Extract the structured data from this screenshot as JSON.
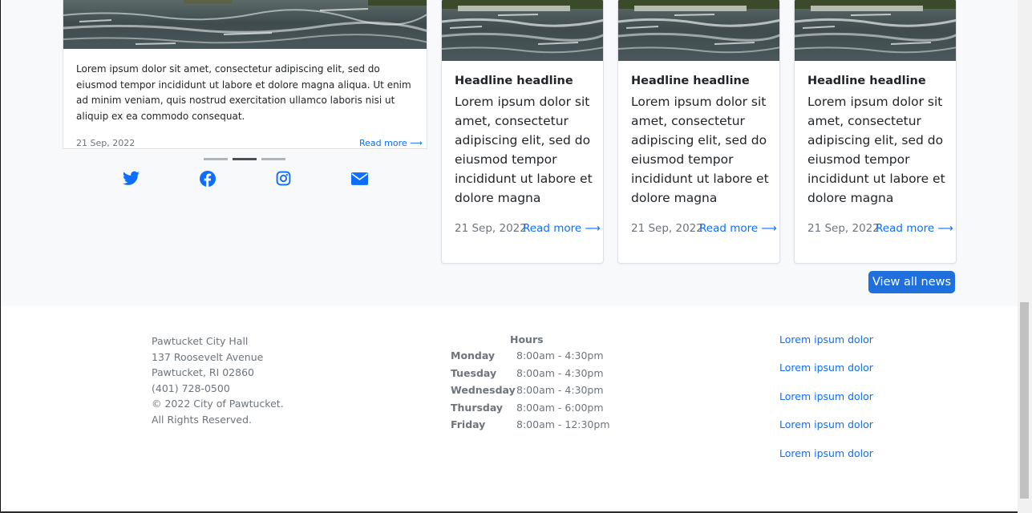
{
  "featured": {
    "text": "Lorem ipsum dolor sit amet, consectetur adipiscing elit, sed do eiusmod tempor incididunt ut labore et dolore magna aliqua. Ut enim ad minim veniam, quis nostrud exercitation ullamco laboris nisi ut aliquip ex ea commodo consequat.",
    "date": "21 Sep, 2022",
    "read_more": "Read more ⟶"
  },
  "carousel": {
    "slides": 3,
    "active_index": 1
  },
  "social": [
    "twitter-icon",
    "facebook-icon",
    "instagram-icon",
    "mail-icon"
  ],
  "cards": [
    {
      "title": "Headline headline",
      "text": "Lorem ipsum dolor sit amet, consectetur adipiscing elit, sed do eiusmod tempor incididunt ut labore et dolore magna",
      "date": "21 Sep, 2022",
      "read_more": "Read more ⟶"
    },
    {
      "title": "Headline headline",
      "text": "Lorem ipsum dolor sit amet, consectetur adipiscing elit, sed do eiusmod tempor incididunt ut labore et dolore magna",
      "date": "21 Sep, 2022",
      "read_more": "Read more ⟶"
    },
    {
      "title": "Headline headline",
      "text": "Lorem ipsum dolor sit amet, consectetur adipiscing elit, sed do eiusmod tempor incididunt ut labore et dolore magna",
      "date": "21 Sep, 2022",
      "read_more": "Read more ⟶"
    }
  ],
  "view_all": "View all news",
  "footer": {
    "address": [
      "Pawtucket City Hall",
      "137 Roosevelt Avenue",
      "Pawtucket, RI 02860",
      "(401) 728-0500",
      "© 2022 City of Pawtucket.",
      "All Rights Reserved."
    ],
    "hours_title": "Hours",
    "hours": [
      {
        "day": "Monday",
        "time": "8:00am - 4:30pm"
      },
      {
        "day": "Tuesday",
        "time": "8:00am - 4:30pm"
      },
      {
        "day": "Wednesday",
        "time": "8:00am - 4:30pm"
      },
      {
        "day": "Thursday",
        "time": "8:00am - 6:00pm"
      },
      {
        "day": "Friday",
        "time": "8:00am - 12:30pm"
      }
    ],
    "links": [
      "Lorem ipsum dolor",
      "Lorem ipsum dolor",
      "Lorem ipsum dolor",
      "Lorem ipsum dolor",
      "Lorem ipsum dolor"
    ]
  },
  "colors": {
    "accent": "#0d6efd",
    "button": "#1f6fdc",
    "muted": "#6c757d",
    "background": "#f8f9fa"
  }
}
